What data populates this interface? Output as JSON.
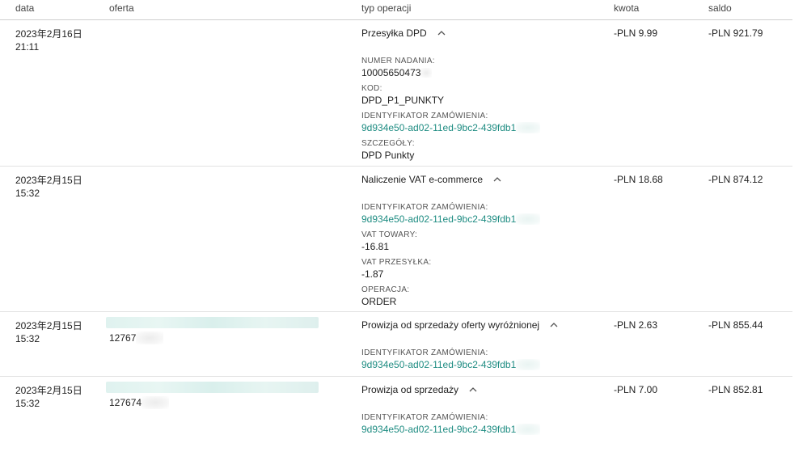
{
  "table": {
    "columns": {
      "date": "data",
      "offer": "oferta",
      "type": "typ operacji",
      "amount": "kwota",
      "balance": "saldo"
    },
    "rows": [
      {
        "date": "2023年2月16日",
        "time": "21:11",
        "type": "Przesyłka DPD",
        "amount": "-PLN 9.99",
        "balance": "-PLN 921.79",
        "details": [
          {
            "label": "NUMER NADANIA:",
            "value": "10005650473"
          },
          {
            "label": "KOD:",
            "value": "DPD_P1_PUNKTY"
          },
          {
            "label": "IDENTYFIKATOR ZAMÓWIENIA:",
            "value": "9d934e50-ad02-11ed-9bc2-439fdb1"
          },
          {
            "label": "SZCZEGÓŁY:",
            "value": "DPD Punkty"
          }
        ]
      },
      {
        "date": "2023年2月15日",
        "time": "15:32",
        "type": "Naliczenie VAT e-commerce",
        "amount": "-PLN 18.68",
        "balance": "-PLN 874.12",
        "details": [
          {
            "label": "IDENTYFIKATOR ZAMÓWIENIA:",
            "value": "9d934e50-ad02-11ed-9bc2-439fdb1"
          },
          {
            "label": "VAT TOWARY:",
            "value": "-16.81"
          },
          {
            "label": "VAT PRZESYŁKA:",
            "value": "-1.87"
          },
          {
            "label": "OPERACJA:",
            "value": "ORDER"
          }
        ]
      },
      {
        "date": "2023年2月15日",
        "time": "15:32",
        "offer_id": "12767",
        "type": "Prowizja od sprzedaży oferty wyróżnionej",
        "amount": "-PLN 2.63",
        "balance": "-PLN 855.44",
        "details": [
          {
            "label": "IDENTYFIKATOR ZAMÓWIENIA:",
            "value": "9d934e50-ad02-11ed-9bc2-439fdb1"
          }
        ]
      },
      {
        "date": "2023年2月15日",
        "time": "15:32",
        "offer_id": "127674",
        "type": "Prowizja od sprzedaży",
        "amount": "-PLN 7.00",
        "balance": "-PLN 852.81",
        "details": [
          {
            "label": "IDENTYFIKATOR ZAMÓWIENIA:",
            "value": "9d934e50-ad02-11ed-9bc2-439fdb1"
          }
        ]
      }
    ]
  },
  "icons": {
    "expand": "chevron-up-icon"
  },
  "colors": {
    "link": "#1e8c82",
    "text": "#222222",
    "divider": "#e2e2e2"
  }
}
